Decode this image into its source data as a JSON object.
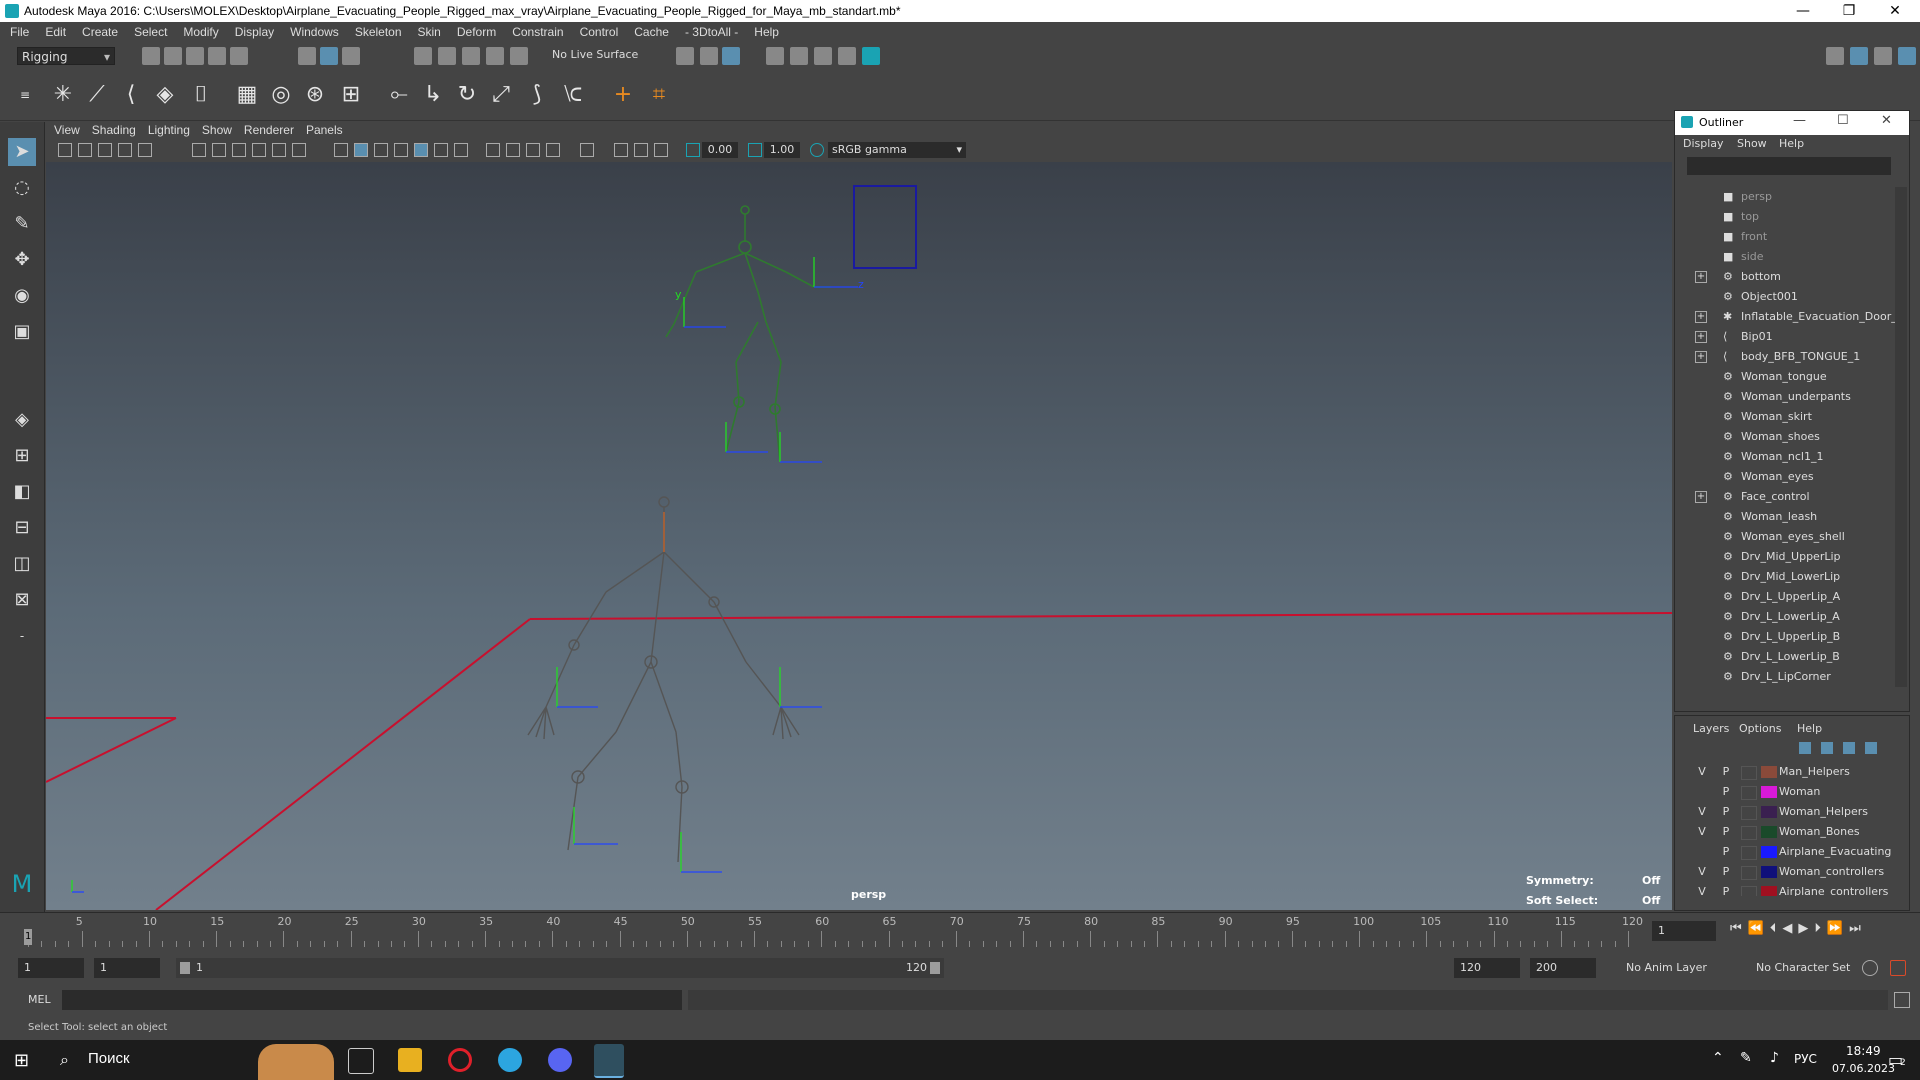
{
  "window": {
    "title": "Autodesk Maya 2016: C:\\Users\\MOLEX\\Desktop\\Airplane_Evacuating_People_Rigged_max_vray\\Airplane_Evacuating_People_Rigged_for_Maya_mb_standart.mb*",
    "minimize": "—",
    "maximize": "❐",
    "close": "✕"
  },
  "menubar": [
    "File",
    "Edit",
    "Create",
    "Select",
    "Modify",
    "Display",
    "Windows",
    "Skeleton",
    "Skin",
    "Deform",
    "Constrain",
    "Control",
    "Cache",
    "- 3DtoAll -",
    "Help"
  ],
  "statusline": {
    "mode": "Rigging",
    "live_surface": "No Live Surface"
  },
  "panel": {
    "menus": [
      "View",
      "Shading",
      "Lighting",
      "Show",
      "Renderer",
      "Panels"
    ],
    "exposure": "0.00",
    "gamma": "1.00",
    "color_space": "sRGB gamma"
  },
  "viewport": {
    "camera_label": "persp",
    "symmetry_label": "Symmetry:",
    "symmetry_value": "Off",
    "soft_select_label": "Soft Select:",
    "soft_select_value": "Off",
    "axis_y": "y",
    "axis_z": "z"
  },
  "outliner": {
    "title": "Outliner",
    "menus": [
      "Display",
      "Show",
      "Help"
    ],
    "items": [
      {
        "label": "persp",
        "type": "camera",
        "expand": false
      },
      {
        "label": "top",
        "type": "camera",
        "expand": false
      },
      {
        "label": "front",
        "type": "camera",
        "expand": false
      },
      {
        "label": "side",
        "type": "camera",
        "expand": false
      },
      {
        "label": "bottom",
        "type": "mesh",
        "expand": true
      },
      {
        "label": "Object001",
        "type": "mesh",
        "expand": false
      },
      {
        "label": "Inflatable_Evacuation_Door_S",
        "type": "joint-star",
        "expand": true
      },
      {
        "label": "Bip01",
        "type": "joint",
        "expand": true
      },
      {
        "label": "body_BFB_TONGUE_1",
        "type": "joint",
        "expand": true
      },
      {
        "label": "Woman_tongue",
        "type": "mesh",
        "expand": false
      },
      {
        "label": "Woman_underpants",
        "type": "mesh",
        "expand": false
      },
      {
        "label": "Woman_skirt",
        "type": "mesh",
        "expand": false
      },
      {
        "label": "Woman_shoes",
        "type": "mesh",
        "expand": false
      },
      {
        "label": "Woman_ncl1_1",
        "type": "mesh",
        "expand": false
      },
      {
        "label": "Woman_eyes",
        "type": "mesh",
        "expand": false
      },
      {
        "label": "Face_control",
        "type": "mesh",
        "expand": true
      },
      {
        "label": "Woman_leash",
        "type": "mesh",
        "expand": false
      },
      {
        "label": "Woman_eyes_shell",
        "type": "mesh",
        "expand": false
      },
      {
        "label": "Drv_Mid_UpperLip",
        "type": "mesh",
        "expand": false
      },
      {
        "label": "Drv_Mid_LowerLip",
        "type": "mesh",
        "expand": false
      },
      {
        "label": "Drv_L_UpperLip_A",
        "type": "mesh",
        "expand": false
      },
      {
        "label": "Drv_L_LowerLip_A",
        "type": "mesh",
        "expand": false
      },
      {
        "label": "Drv_L_UpperLip_B",
        "type": "mesh",
        "expand": false
      },
      {
        "label": "Drv_L_LowerLip_B",
        "type": "mesh",
        "expand": false
      },
      {
        "label": "Drv_L_LipCorner",
        "type": "mesh",
        "expand": false
      }
    ]
  },
  "layers": {
    "menus": [
      "Layers",
      "Options",
      "Help"
    ],
    "items": [
      {
        "v": "V",
        "p": "P",
        "label": "Man_Helpers",
        "color": "#8a4a3a"
      },
      {
        "v": "",
        "p": "P",
        "label": "Woman",
        "color": "#d81ad8"
      },
      {
        "v": "V",
        "p": "P",
        "label": "Woman_Helpers",
        "color": "#3a2050"
      },
      {
        "v": "V",
        "p": "P",
        "label": "Woman_Bones",
        "color": "#1a4a2a"
      },
      {
        "v": "",
        "p": "P",
        "label": "Airplane_Evacuating",
        "color": "#1a1aff"
      },
      {
        "v": "V",
        "p": "P",
        "label": "Woman_controllers",
        "color": "#10107a"
      },
      {
        "v": "V",
        "p": "P",
        "label": "Airplane_controllers",
        "color": "#a01020"
      }
    ]
  },
  "timeline": {
    "ticks": [
      "5",
      "10",
      "15",
      "20",
      "25",
      "30",
      "35",
      "40",
      "45",
      "50",
      "55",
      "60",
      "65",
      "70",
      "75",
      "80",
      "85",
      "90",
      "95",
      "100",
      "105",
      "110",
      "115",
      "120"
    ],
    "current_frame_marker": "1",
    "current_frame": "1"
  },
  "range": {
    "start": "1",
    "start2": "1",
    "slider_start": "1",
    "slider_end": "120",
    "end": "120",
    "end2": "200",
    "anim_layer": "No Anim Layer",
    "character_set": "No Character Set"
  },
  "cmdline": {
    "label": "MEL"
  },
  "helpline": {
    "text": "Select Tool: select an object"
  },
  "taskbar": {
    "search": "Поиск",
    "lang": "РУС",
    "time": "18:49",
    "date": "07.06.2023",
    "notif_count": "2"
  },
  "colors": {
    "accent": "#1aa3b3",
    "bone_green": "#2f7a2f",
    "bone_orange": "#a0603a",
    "grid_red": "#c8102e",
    "axis_y": "#22dd22",
    "axis_z": "#2244ff"
  }
}
